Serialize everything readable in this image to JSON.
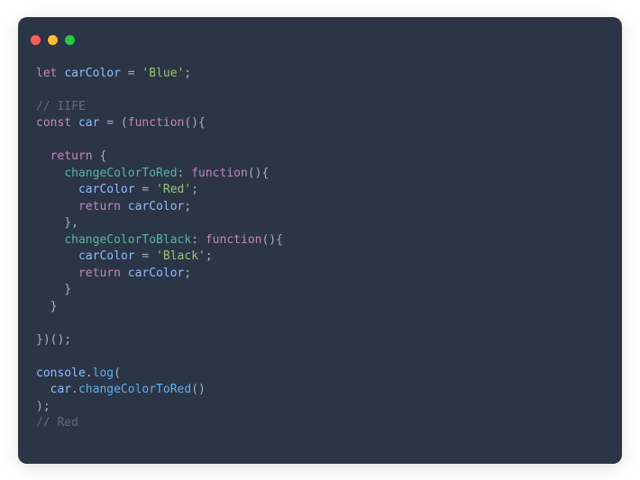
{
  "code": {
    "lines": [
      [
        {
          "cls": "kw",
          "t": "let"
        },
        {
          "cls": "punc",
          "t": " "
        },
        {
          "cls": "id",
          "t": "carColor"
        },
        {
          "cls": "punc",
          "t": " = "
        },
        {
          "cls": "str",
          "t": "'Blue'"
        },
        {
          "cls": "punc",
          "t": ";"
        }
      ],
      [],
      [
        {
          "cls": "cmt",
          "t": "// IIFE"
        }
      ],
      [
        {
          "cls": "kw",
          "t": "const"
        },
        {
          "cls": "punc",
          "t": " "
        },
        {
          "cls": "id",
          "t": "car"
        },
        {
          "cls": "punc",
          "t": " = ("
        },
        {
          "cls": "kw",
          "t": "function"
        },
        {
          "cls": "punc",
          "t": "(){"
        }
      ],
      [],
      [
        {
          "cls": "punc",
          "t": "  "
        },
        {
          "cls": "kw",
          "t": "return"
        },
        {
          "cls": "punc",
          "t": " {"
        }
      ],
      [
        {
          "cls": "punc",
          "t": "    "
        },
        {
          "cls": "prop",
          "t": "changeColorToRed"
        },
        {
          "cls": "punc",
          "t": ": "
        },
        {
          "cls": "kw",
          "t": "function"
        },
        {
          "cls": "punc",
          "t": "(){"
        }
      ],
      [
        {
          "cls": "punc",
          "t": "      "
        },
        {
          "cls": "id",
          "t": "carColor"
        },
        {
          "cls": "punc",
          "t": " = "
        },
        {
          "cls": "str",
          "t": "'Red'"
        },
        {
          "cls": "punc",
          "t": ";"
        }
      ],
      [
        {
          "cls": "punc",
          "t": "      "
        },
        {
          "cls": "kw",
          "t": "return"
        },
        {
          "cls": "punc",
          "t": " "
        },
        {
          "cls": "id",
          "t": "carColor"
        },
        {
          "cls": "punc",
          "t": ";"
        }
      ],
      [
        {
          "cls": "punc",
          "t": "    },"
        }
      ],
      [
        {
          "cls": "punc",
          "t": "    "
        },
        {
          "cls": "prop",
          "t": "changeColorToBlack"
        },
        {
          "cls": "punc",
          "t": ": "
        },
        {
          "cls": "kw",
          "t": "function"
        },
        {
          "cls": "punc",
          "t": "(){"
        }
      ],
      [
        {
          "cls": "punc",
          "t": "      "
        },
        {
          "cls": "id",
          "t": "carColor"
        },
        {
          "cls": "punc",
          "t": " = "
        },
        {
          "cls": "str",
          "t": "'Black'"
        },
        {
          "cls": "punc",
          "t": ";"
        }
      ],
      [
        {
          "cls": "punc",
          "t": "      "
        },
        {
          "cls": "kw",
          "t": "return"
        },
        {
          "cls": "punc",
          "t": " "
        },
        {
          "cls": "id",
          "t": "carColor"
        },
        {
          "cls": "punc",
          "t": ";"
        }
      ],
      [
        {
          "cls": "punc",
          "t": "    }"
        }
      ],
      [
        {
          "cls": "punc",
          "t": "  }"
        }
      ],
      [],
      [
        {
          "cls": "punc",
          "t": "})();"
        }
      ],
      [],
      [
        {
          "cls": "obj",
          "t": "console"
        },
        {
          "cls": "punc",
          "t": "."
        },
        {
          "cls": "fn",
          "t": "log"
        },
        {
          "cls": "punc",
          "t": "("
        }
      ],
      [
        {
          "cls": "punc",
          "t": "  "
        },
        {
          "cls": "id",
          "t": "car"
        },
        {
          "cls": "punc",
          "t": "."
        },
        {
          "cls": "fn",
          "t": "changeColorToRed"
        },
        {
          "cls": "punc",
          "t": "()"
        }
      ],
      [
        {
          "cls": "punc",
          "t": ");"
        }
      ],
      [
        {
          "cls": "cmt",
          "t": "// Red"
        }
      ]
    ]
  }
}
